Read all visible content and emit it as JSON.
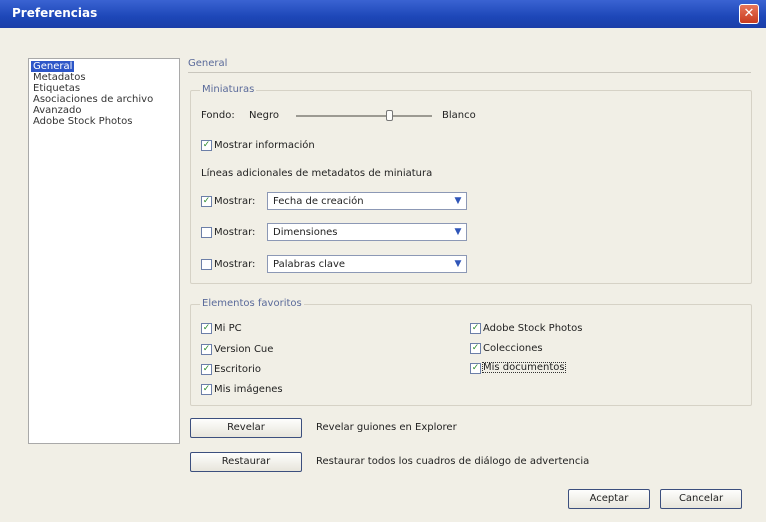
{
  "window": {
    "title": "Preferencias",
    "close_glyph": "✕"
  },
  "nav": {
    "items": [
      "General",
      "Metadatos",
      "Etiquetas",
      "Asociaciones de archivo",
      "Avanzado",
      "Adobe Stock Photos"
    ],
    "selected_index": 0
  },
  "section_title": "General",
  "thumbnails": {
    "group_label": "Miniaturas",
    "background_label": "Fondo:",
    "slider_left": "Negro",
    "slider_right": "Blanco",
    "slider_value": 0.68,
    "show_info_label": "Mostrar información",
    "show_info_checked": true,
    "extra_lines_label": "Líneas adicionales de metadatos de miniatura",
    "lines": [
      {
        "label": "Mostrar:",
        "checked": true,
        "value": "Fecha de creación"
      },
      {
        "label": "Mostrar:",
        "checked": false,
        "value": "Dimensiones"
      },
      {
        "label": "Mostrar:",
        "checked": false,
        "value": "Palabras clave"
      }
    ]
  },
  "favorites": {
    "group_label": "Elementos favoritos",
    "left": [
      {
        "label": "Mi PC",
        "checked": true
      },
      {
        "label": "Version Cue",
        "checked": true
      },
      {
        "label": "Escritorio",
        "checked": true
      },
      {
        "label": "Mis imágenes",
        "checked": true
      }
    ],
    "right": [
      {
        "label": "Adobe Stock Photos",
        "checked": true
      },
      {
        "label": "Colecciones",
        "checked": true
      },
      {
        "label": "Mis documentos",
        "checked": true
      }
    ]
  },
  "actions": {
    "reveal_button": "Revelar",
    "reveal_desc": "Revelar guiones en Explorer",
    "restore_button": "Restaurar",
    "restore_desc": "Restaurar todos los cuadros de diálogo de advertencia"
  },
  "footer": {
    "ok": "Aceptar",
    "cancel": "Cancelar"
  },
  "colors": {
    "titlebar": "#1d47b8",
    "selection": "#2d56c8",
    "check": "#2d8a2d"
  }
}
